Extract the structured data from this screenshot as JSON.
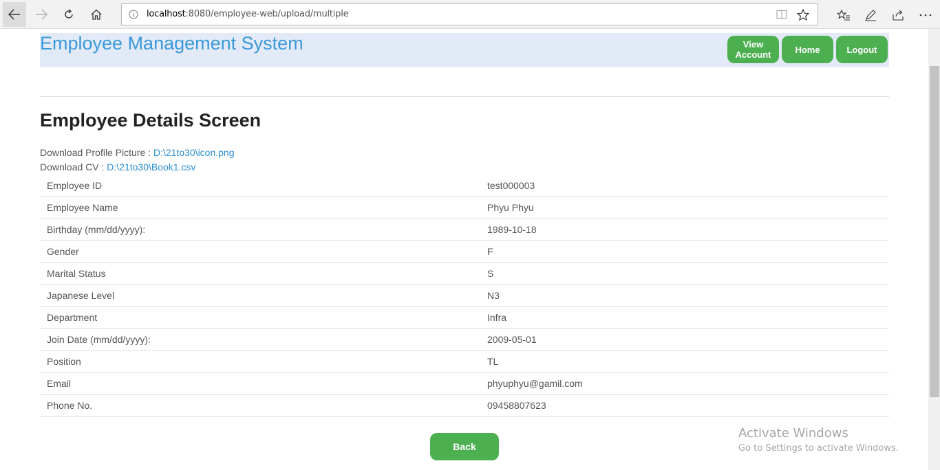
{
  "browser": {
    "url_host": "localhost",
    "url_rest": ":8080/employee-web/upload/multiple"
  },
  "header": {
    "title": "Employee Management System",
    "view_account_line1": "View",
    "view_account_line2": "Account",
    "home_label": "Home",
    "logout_label": "Logout"
  },
  "main": {
    "screen_title": "Employee Details Screen",
    "download_picture_label": "Download Profile Picture : ",
    "download_picture_link": "D:\\21to30\\icon.png",
    "download_cv_label": "Download CV : ",
    "download_cv_link": "D:\\21to30\\Book1.csv",
    "rows": [
      {
        "label": "Employee ID",
        "value": "test000003"
      },
      {
        "label": "Employee Name",
        "value": "Phyu Phyu"
      },
      {
        "label": "Birthday (mm/dd/yyyy):",
        "value": "1989-10-18"
      },
      {
        "label": "Gender",
        "value": "F"
      },
      {
        "label": "Marital Status",
        "value": "S"
      },
      {
        "label": "Japanese Level",
        "value": "N3"
      },
      {
        "label": "Department",
        "value": "Infra"
      },
      {
        "label": "Join Date (mm/dd/yyyy):",
        "value": "2009-05-01"
      },
      {
        "label": "Position",
        "value": "TL"
      },
      {
        "label": "Email",
        "value": "phyuphyu@gamil.com"
      },
      {
        "label": "Phone No.",
        "value": "09458807623"
      }
    ],
    "back_label": "Back"
  },
  "watermark": {
    "line1": "Activate Windows",
    "line2": "Go to Settings to activate Windows."
  },
  "colors": {
    "accent_green": "#4caf50",
    "title_blue": "#3a99d8",
    "link_blue": "#2b8fd0",
    "header_bg": "#e3eaf7"
  }
}
